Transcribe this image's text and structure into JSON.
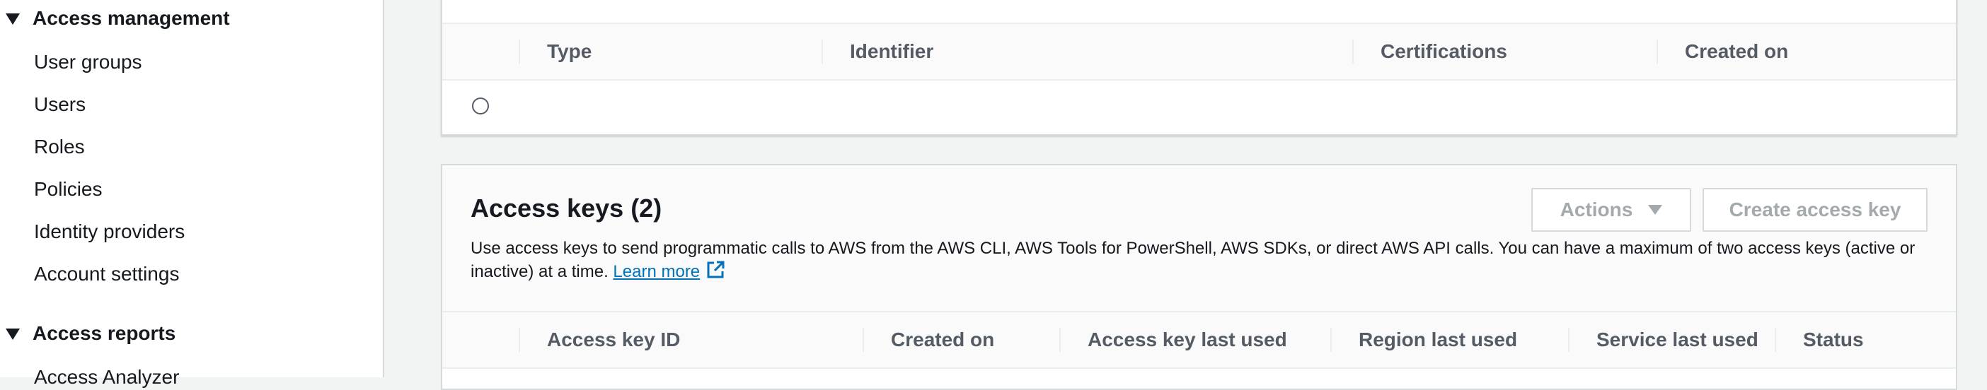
{
  "sidebar": {
    "sections": [
      {
        "label": "Access management"
      },
      {
        "label": "Access reports"
      }
    ],
    "items": [
      {
        "label": "User groups"
      },
      {
        "label": "Users"
      },
      {
        "label": "Roles"
      },
      {
        "label": "Policies"
      },
      {
        "label": "Identity providers"
      },
      {
        "label": "Account settings"
      },
      {
        "label": "Access Analyzer"
      }
    ]
  },
  "mfa_table": {
    "columns": [
      "Type",
      "Identifier",
      "Certifications",
      "Created on"
    ]
  },
  "access_keys": {
    "title": "Access keys (2)",
    "description": "Use access keys to send programmatic calls to AWS from the AWS CLI, AWS Tools for PowerShell, AWS SDKs, or direct AWS API calls. You can have a maximum of two access keys (active or inactive) at a time.",
    "learn_more": "Learn more",
    "actions_label": "Actions",
    "create_label": "Create access key",
    "columns": [
      "Access key ID",
      "Created on",
      "Access key last used",
      "Region last used",
      "Service last used",
      "Status"
    ]
  },
  "colors": {
    "link": "#0073bb",
    "disabled_text": "#a3aaae",
    "border": "#d5dbdb"
  }
}
